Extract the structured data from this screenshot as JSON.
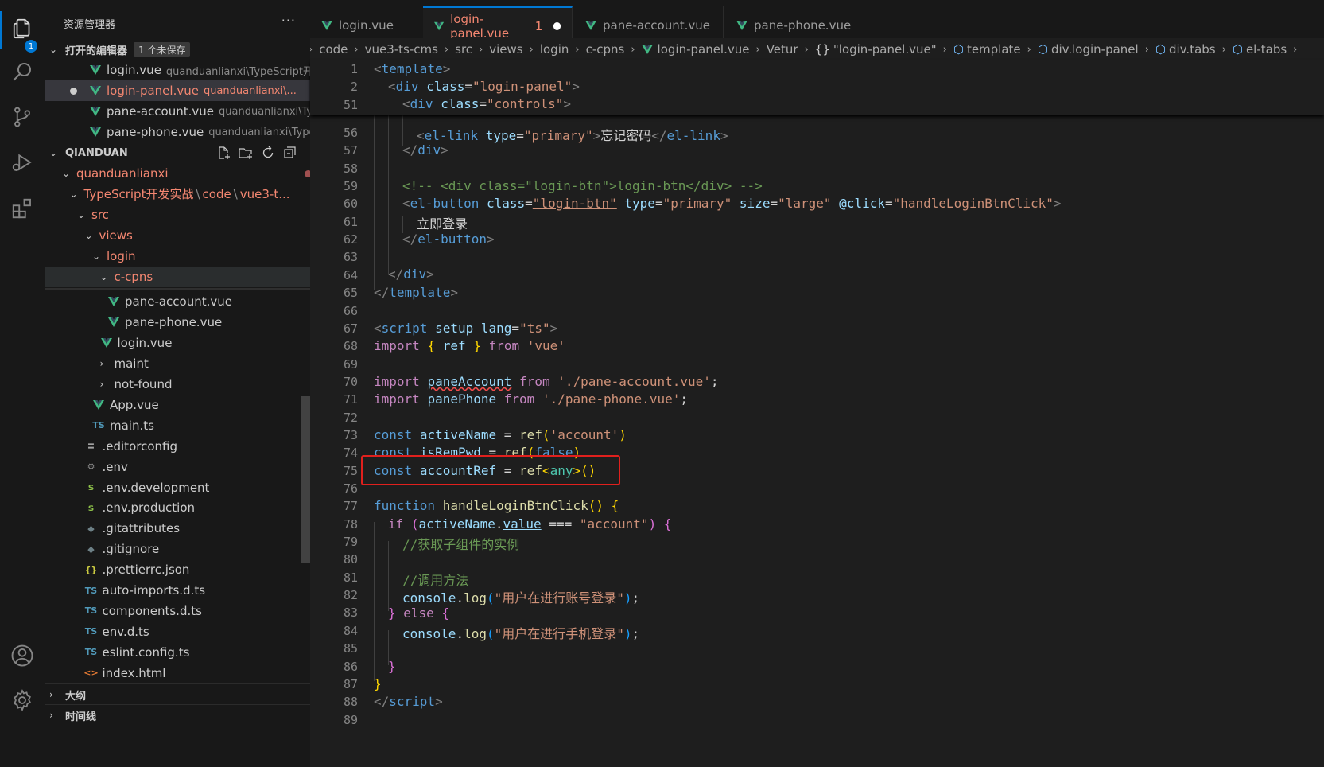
{
  "activity_bar": {
    "items": [
      {
        "icon": "files-icon",
        "badge": "1"
      },
      {
        "icon": "search-icon"
      },
      {
        "icon": "source-control-icon"
      },
      {
        "icon": "run-debug-icon"
      },
      {
        "icon": "extensions-icon"
      }
    ],
    "bottom": [
      {
        "icon": "account-icon"
      },
      {
        "icon": "settings-gear-icon"
      }
    ]
  },
  "sidebar": {
    "title": "资源管理器",
    "more": "···",
    "open_editors": {
      "label": "打开的编辑器",
      "unsaved_badge": "1 个未保存",
      "items": [
        {
          "name": "login.vue",
          "desc": "quanduanlianxi\\TypeScript开..."
        },
        {
          "name": "login-panel.vue",
          "desc": "quanduanlianxi\\...",
          "count": "1"
        },
        {
          "name": "pane-account.vue",
          "desc": "quanduanlianxi\\Ty..."
        },
        {
          "name": "pane-phone.vue",
          "desc": "quanduanlianxi\\Type..."
        }
      ]
    },
    "workspace": {
      "label": "QIANDUAN",
      "tree": [
        {
          "name": "quanduanlianxi"
        },
        {
          "name": "TypeScript开发实战",
          "sep": "\\",
          "p2": "code",
          "p3": "vue3-t..."
        },
        {
          "name": "src"
        },
        {
          "name": "views"
        },
        {
          "name": "login"
        },
        {
          "name": "c-cpns"
        },
        {
          "name": "pane-account.vue"
        },
        {
          "name": "pane-phone.vue"
        },
        {
          "name": "login.vue"
        },
        {
          "name": "maint"
        },
        {
          "name": "not-found"
        },
        {
          "name": "App.vue"
        },
        {
          "name": "main.ts",
          "icon": "TS"
        },
        {
          "name": ".editorconfig",
          "icon": "≡"
        },
        {
          "name": ".env"
        },
        {
          "name": ".env.development",
          "icon": "$"
        },
        {
          "name": ".env.production",
          "icon": "$"
        },
        {
          "name": ".gitattributes"
        },
        {
          "name": ".gitignore"
        },
        {
          "name": ".prettierrc.json",
          "icon": "{}"
        },
        {
          "name": "auto-imports.d.ts",
          "icon": "TS"
        },
        {
          "name": "components.d.ts",
          "icon": "TS"
        },
        {
          "name": "env.d.ts",
          "icon": "TS"
        },
        {
          "name": "eslint.config.ts",
          "icon": "TS"
        },
        {
          "name": "index.html",
          "icon": "<>"
        }
      ]
    },
    "outline": "大纲",
    "timeline": "时间线"
  },
  "tabs": [
    {
      "name": "login.vue"
    },
    {
      "name": "login-panel.vue",
      "problems": "1"
    },
    {
      "name": "pane-account.vue"
    },
    {
      "name": "pane-phone.vue"
    }
  ],
  "breadcrumb": [
    "code",
    "vue3-ts-cms",
    "src",
    "views",
    "login",
    "c-cpns",
    "login-panel.vue",
    "Vetur",
    "\"login-panel.vue\"",
    "template",
    "div.login-panel",
    "div.tabs",
    "el-tabs"
  ],
  "breadcrumb_icons": {
    "braces": "{}"
  },
  "sticky_lines": [
    "1",
    "2",
    "51"
  ],
  "line_numbers": [
    "56",
    "57",
    "58",
    "59",
    "60",
    "61",
    "62",
    "63",
    "64",
    "65",
    "66",
    "67",
    "68",
    "69",
    "70",
    "71",
    "72",
    "73",
    "74",
    "75",
    "76",
    "77",
    "78",
    "79",
    "80",
    "81",
    "82",
    "83",
    "84",
    "85",
    "86",
    "87",
    "88",
    "89"
  ],
  "code_text": {
    "l1": "template",
    "l2_tag": "div",
    "l2_attr": "class",
    "l2_val": "\"login-panel\"",
    "l51_tag": "div",
    "l51_attr": "class",
    "l51_val": "\"controls\"",
    "l56_tag": "el-link",
    "l56_attr": "type",
    "l56_val": "\"primary\"",
    "l56_text": "忘记密码",
    "l59": "<!-- <div class=\"login-btn\">login-btn</div> -->",
    "l60_tag": "el-button",
    "l60_a1": "class",
    "l60_v1": "\"login-btn\"",
    "l60_a2": "type",
    "l60_v2": "\"primary\"",
    "l60_a3": "size",
    "l60_v3": "\"large\"",
    "l60_a4": "@click",
    "l60_v4": "\"handleLoginBtnClick\"",
    "l61": "立即登录",
    "l62": "el-button",
    "l64": "div",
    "l65": "template",
    "l67_tag": "script",
    "l67_a1": "setup",
    "l67_a2": "lang",
    "l67_v2": "\"ts\"",
    "l68_kw": "import",
    "l68_name": "ref",
    "l68_from": "from",
    "l68_src": "'vue'",
    "l70_kw": "import",
    "l70_name": "paneAccount",
    "l70_from": "from",
    "l70_src": "'./pane-account.vue'",
    "l71_kw": "import",
    "l71_name": "panePhone",
    "l71_from": "from",
    "l71_src": "'./pane-phone.vue'",
    "l73_kw": "const",
    "l73_name": "activeName",
    "l73_fn": "ref",
    "l73_arg": "'account'",
    "l74_kw": "const",
    "l74_name": "isRemPwd",
    "l74_fn": "ref",
    "l74_arg": "false",
    "l75_kw": "const",
    "l75_name": "accountRef",
    "l75_fn": "ref",
    "l75_ty": "any",
    "l77_kw": "function",
    "l77_fn": "handleLoginBtnClick",
    "l78_kw": "if",
    "l78_var": "activeName",
    "l78_prop": "value",
    "l78_op": "===",
    "l78_str": "\"account\"",
    "l79": "//获取子组件的实例",
    "l81": "//调用方法",
    "l82_obj": "console",
    "l82_fn": "log",
    "l82_str": "\"用户在进行账号登录\"",
    "l83_kw": "else",
    "l84_obj": "console",
    "l84_fn": "log",
    "l84_str": "\"用户在进行手机登录\"",
    "l88": "script"
  },
  "colors": {
    "accent": "#0078d4",
    "error": "#f48771",
    "highlight_box": "#e0201d"
  }
}
